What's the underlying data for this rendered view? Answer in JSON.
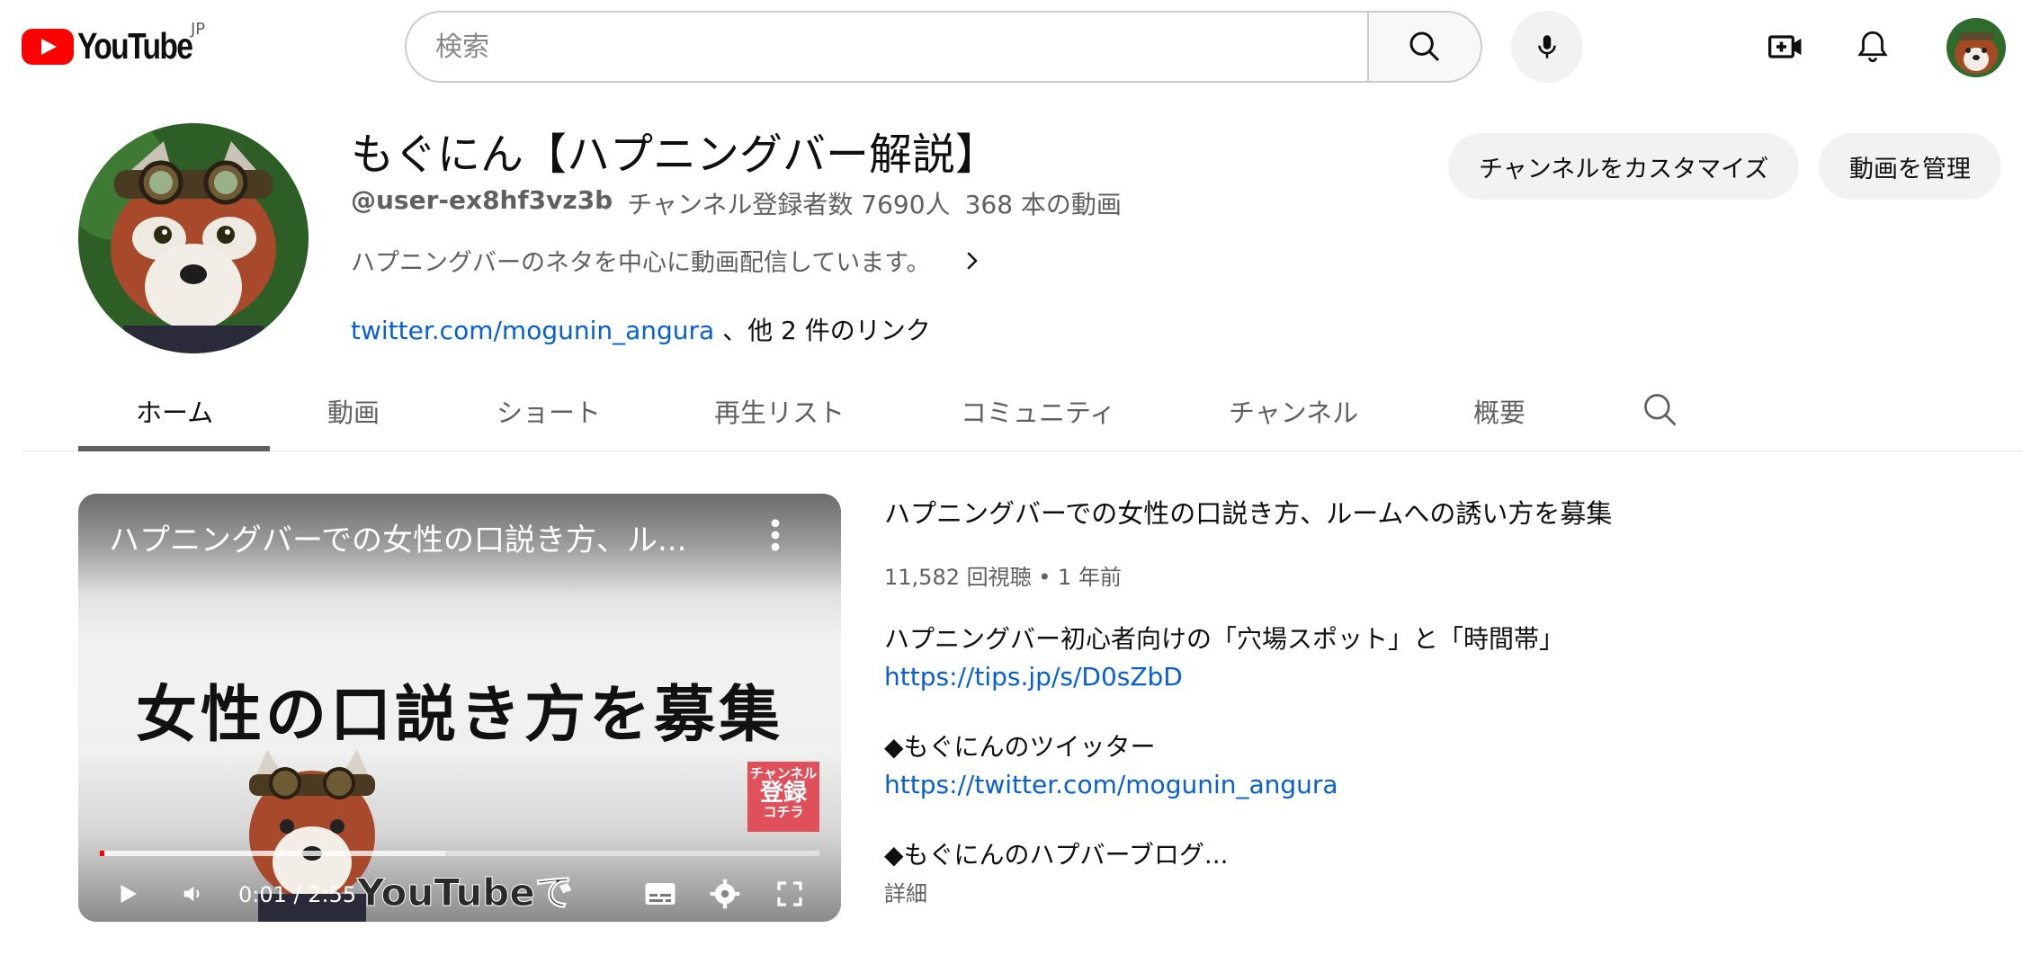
{
  "header": {
    "logo_text": "YouTube",
    "logo_country": "JP",
    "search_placeholder": "検索"
  },
  "channel": {
    "name": "もぐにん【ハプニングバー解説】",
    "handle": "@user-ex8hf3vz3b",
    "subscribers": "チャンネル登録者数 7690人",
    "video_count": "368 本の動画",
    "description": "ハプニングバーのネタを中心に動画配信しています。",
    "link_text": "twitter.com/mogunin_angura",
    "links_more": "、他 2 件のリンク",
    "customize_button": "チャンネルをカスタマイズ",
    "manage_button": "動画を管理"
  },
  "tabs": [
    {
      "label": "ホーム",
      "active": true
    },
    {
      "label": "動画",
      "active": false
    },
    {
      "label": "ショート",
      "active": false
    },
    {
      "label": "再生リスト",
      "active": false
    },
    {
      "label": "コミュニティ",
      "active": false
    },
    {
      "label": "チャンネル",
      "active": false
    },
    {
      "label": "概要",
      "active": false
    }
  ],
  "featured": {
    "player_title": "ハプニングバーでの女性の口説き方、ル...",
    "thumbnail_text": "女性の口説き方を募集",
    "badge_top": "チャンネル",
    "badge_mid": "登録",
    "badge_bottom": "コチラ",
    "overlay_text": "YouTubeで",
    "time": "0:01 / 2:55",
    "progress_played": 0.006,
    "progress_loaded": 0.48,
    "title": "ハプニングバーでの女性の口説き方、ルームへの誘い方を募集",
    "stats": "11,582 回視聴 • 1 年前",
    "desc_line1": "ハプニングバー初心者向けの「穴場スポット」と「時間帯」",
    "desc_link1": "https://tips.jp/s/D0sZbD",
    "desc_line2": "◆もぐにんのツイッター",
    "desc_link2": "https://twitter.com/mogunin_angura",
    "desc_line3": "◆もぐにんのハプバーブログ...",
    "more": "詳細"
  },
  "colors": {
    "brand_red": "#ff0000",
    "link_blue": "#065fd4",
    "badge_red": "#e0505a"
  }
}
